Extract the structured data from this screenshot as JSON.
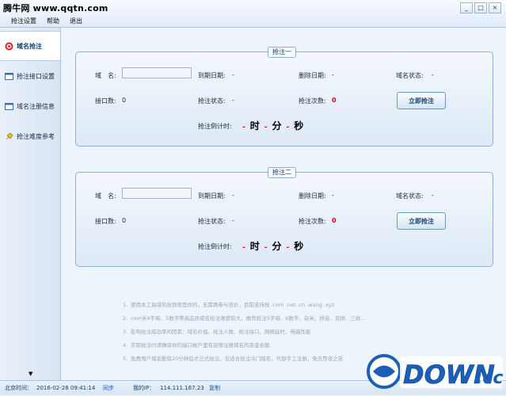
{
  "watermark": "腾牛网 www.qqtn.com",
  "menu": [
    "抢注设置",
    "帮助",
    "退出"
  ],
  "window_buttons": [
    "_",
    "□",
    "×"
  ],
  "sidebar": {
    "items": [
      {
        "label": "域名抢注",
        "icon": "target-icon"
      },
      {
        "label": "抢注接口设置",
        "icon": "window-icon"
      },
      {
        "label": "域名注册信息",
        "icon": "window-icon"
      },
      {
        "label": "抢注难度参考",
        "icon": "pin-icon"
      }
    ],
    "scroll_down": "▼"
  },
  "panels": [
    {
      "title": "抢注一",
      "domain_label": "域　名:",
      "domain_value": "",
      "expire_label": "到期日期:",
      "expire_value": "-",
      "delete_label": "删除日期:",
      "delete_value": "-",
      "status_label": "域名状态:",
      "status_value": "-",
      "interfaces_label": "接口数:",
      "interfaces_value": "0",
      "snipe_status_label": "抢注状态:",
      "snipe_status_value": "-",
      "attempts_label": "抢注次数:",
      "attempts_value": "0",
      "button": "立即抢注",
      "countdown_label": "抢注倒计时:",
      "countdown": {
        "hours": "-",
        "h_unit": "时",
        "minutes": "-",
        "m_unit": "分",
        "seconds": "-",
        "s_unit": "秒"
      }
    },
    {
      "title": "抢注二",
      "domain_label": "域　名:",
      "domain_value": "",
      "expire_label": "到期日期:",
      "expire_value": "-",
      "delete_label": "删除日期:",
      "delete_value": "-",
      "status_label": "域名状态:",
      "status_value": "-",
      "interfaces_label": "接口数:",
      "interfaces_value": "0",
      "snipe_status_label": "抢注状态:",
      "snipe_status_value": "-",
      "attempts_label": "抢注次数:",
      "attempts_value": "0",
      "button": "立即抢注",
      "countdown_label": "抢注倒计时:",
      "countdown": {
        "hours": "-",
        "h_unit": "时",
        "minutes": "-",
        "m_unit": "分",
        "seconds": "-",
        "s_unit": "秒"
      }
    }
  ],
  "notes": [
    {
      "num": "1.",
      "text": "使用本工具域名抢到就是你的，无需再参与竞价，目前支持抢 .com .net .cn .wang .xyz"
    },
    {
      "num": "2.",
      "text": "com米4字母、5数字等高品质域名抢注难度较大，推荐抢注5字母、6数字、杂米、拼音、双拼、三拼..."
    },
    {
      "num": "3.",
      "text": "影响抢注成功率的因素：域名价值、抢注人数、抢注接口、网络延时、电脑性能"
    },
    {
      "num": "4.",
      "text": "实际抢注时请确保你的接口帐户里有足够注册域名的资金余额"
    },
    {
      "num": "5.",
      "text": "免费用户域名删除20分钟后才正式抢注，仅适合抢注冷门域名，代替手工注册，免去熬夜之苦"
    }
  ],
  "statusbar": {
    "time_label": "北京时间：",
    "time_value": "2016-02-28 09:41:14",
    "sync": "同步",
    "ip_label": "我的IP：",
    "ip_value": "114.111.167.23",
    "copy": "复制"
  },
  "logo": {
    "text": "DOWN",
    "suffix": ".cc"
  },
  "colors": {
    "accent_red": "#e00000",
    "panel_border": "#8fb0d6",
    "logo_blue": "#1b5fb8"
  }
}
